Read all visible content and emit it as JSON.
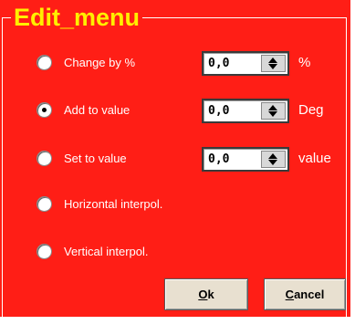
{
  "dialog": {
    "title": "Edit_menu",
    "options": [
      {
        "label": "Change by %",
        "selected": false,
        "value": "0,0",
        "unit": "%"
      },
      {
        "label": "Add to value",
        "selected": true,
        "value": "0,0",
        "unit": "Deg"
      },
      {
        "label": "Set to value",
        "selected": false,
        "value": "0,0",
        "unit": "value"
      },
      {
        "label": "Horizontal interpol.",
        "selected": false
      },
      {
        "label": "Vertical interpol.",
        "selected": false
      }
    ],
    "buttons": {
      "ok_accel": "O",
      "ok_rest": "k",
      "cancel_accel": "C",
      "cancel_rest": "ancel"
    }
  },
  "colors": {
    "panel": "#ff1e16",
    "title": "#ffef00",
    "text": "#ffffff"
  },
  "icons": {
    "spin_up": "triangle-up",
    "spin_down": "triangle-down",
    "radio": "circle"
  }
}
